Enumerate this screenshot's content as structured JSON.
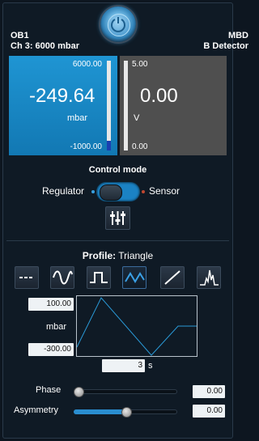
{
  "header": {
    "left_title": "OB1",
    "left_sub": "Ch 3: 6000 mbar",
    "right_title": "MBD",
    "right_sub": "B Detector"
  },
  "left_display": {
    "max": "6000.00",
    "min": "-1000.00",
    "value": "-249.64",
    "unit": "mbar",
    "level_fraction": 0.107
  },
  "right_display": {
    "max": "5.00",
    "min": "0.00",
    "value": "0.00",
    "unit": "V",
    "level_fraction": 0.0
  },
  "control_mode": {
    "title": "Control mode",
    "left_label": "Regulator",
    "right_label": "Sensor",
    "selected": "Regulator"
  },
  "profile": {
    "title_prefix": "Profile:",
    "selected": "Triangle",
    "waveforms": [
      "constant-icon",
      "sine-icon",
      "square-icon",
      "triangle-icon",
      "ramp-icon",
      "custom-icon"
    ],
    "max_value": "100.00",
    "unit": "mbar",
    "min_value": "-300.00",
    "period_value": "3",
    "period_unit": "s"
  },
  "phase": {
    "label": "Phase",
    "value": "0.00",
    "fraction": 0.0
  },
  "asymmetry": {
    "label": "Asymmetry",
    "value": "0.00",
    "fraction": 0.5
  },
  "colors": {
    "accent": "#1b82c4",
    "background": "#0f1a25",
    "display_left": "#1a8bcb",
    "display_right": "#4f4f4f"
  }
}
